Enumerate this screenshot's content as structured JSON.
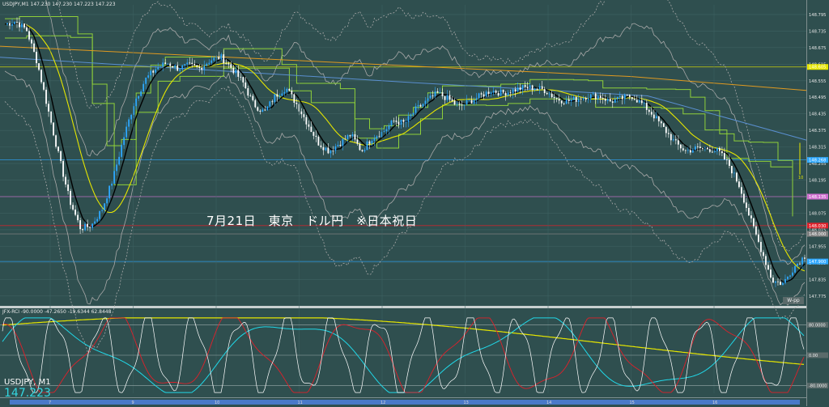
{
  "chart_header": "USDJPY,M1  147.230 147.230 147.223 147.223",
  "rci_header": "JFX-RCI -90.0000 -47.2650 -19.6344 62.8448",
  "annotation": "7月21日　東京　ドル円　※日本祝日",
  "symbol_label": "USDJPY, M1",
  "bid_value": "147.223",
  "wpp_label": "W-pp",
  "marker_label": "10",
  "colors": {
    "background": "#2f4f4f",
    "up_candle": "#2da8ff",
    "down_candle": "#ffffff",
    "ma_fast": "#000000",
    "ma_yellow": "#e6e600",
    "ichimoku_green": "#8fd03a",
    "ichimoku_orange": "#e09a20",
    "bollinger": "#a9a9a9",
    "rci_short": "#ffffff",
    "rci_mid": "#e0202a",
    "rci_long": "#20d8e8",
    "rci_yellow": "#e6e600"
  },
  "chart_data": {
    "type": "line",
    "price_axis_ticks": [
      "148.795",
      "148.735",
      "148.675",
      "148.615",
      "148.555",
      "148.495",
      "148.435",
      "148.375",
      "148.315",
      "148.255",
      "148.195",
      "148.135",
      "148.075",
      "148.015",
      "147.955",
      "147.895",
      "147.835",
      "147.775"
    ],
    "price_axis_range": [
      147.745,
      148.83
    ],
    "price_level_labels": [
      {
        "label": "148.605",
        "value": 148.605,
        "color": "#e6e600"
      },
      {
        "label": "148.268",
        "value": 148.268,
        "color": "#2da8ff"
      },
      {
        "label": "148.135",
        "value": 148.135,
        "color": "#d070d0"
      },
      {
        "label": "148.030",
        "value": 148.03,
        "color": "#e0202a"
      },
      {
        "label": "148.000",
        "value": 148.0,
        "color": "#808080"
      },
      {
        "label": "147.900",
        "value": 147.9,
        "color": "#2da8ff"
      }
    ],
    "time_axis_labels": [
      "7",
      "9",
      "10",
      "11",
      "12",
      "13",
      "14",
      "15",
      "16"
    ],
    "price_series": [
      148.76,
      148.77,
      148.74,
      148.62,
      148.45,
      148.28,
      148.12,
      148.02,
      148.03,
      148.09,
      148.2,
      148.35,
      148.48,
      148.56,
      148.6,
      148.62,
      148.6,
      148.61,
      148.6,
      148.63,
      148.64,
      148.6,
      148.55,
      148.47,
      148.44,
      148.5,
      148.53,
      148.47,
      148.4,
      148.33,
      148.3,
      148.33,
      148.36,
      148.3,
      148.35,
      148.37,
      148.41,
      148.4,
      148.45,
      148.48,
      148.51,
      148.49,
      148.46,
      148.48,
      148.5,
      148.52,
      148.51,
      148.52,
      148.53,
      148.53,
      148.52,
      148.49,
      148.48,
      148.49,
      148.5,
      148.5,
      148.48,
      148.49,
      148.5,
      148.47,
      148.43,
      148.38,
      148.33,
      148.3,
      148.31,
      148.31,
      148.3,
      148.25,
      148.17,
      148.05,
      147.94,
      147.83,
      147.82,
      147.88,
      147.92
    ],
    "rci_range": [
      -100,
      100
    ],
    "rci_levels": [
      "80.0000",
      "0.00",
      "-80.0000"
    ]
  }
}
